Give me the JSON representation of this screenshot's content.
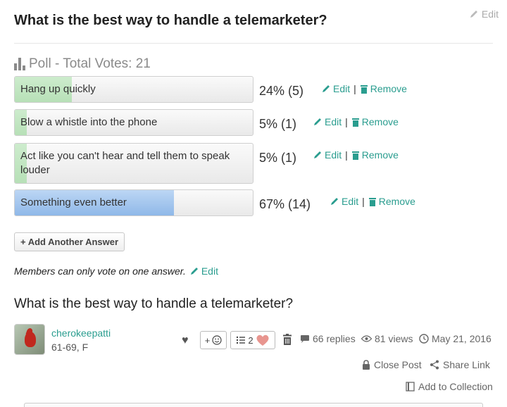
{
  "header": {
    "title": "What is the best way to handle a telemarketer?",
    "edit_label": "Edit"
  },
  "poll": {
    "heading": "Poll - Total Votes: 21",
    "options": [
      {
        "label": "Hang up quickly",
        "result": "24% (5)",
        "fraction": 0.24,
        "color": "green"
      },
      {
        "label": "Blow a whistle into the phone",
        "result": "5% (1)",
        "fraction": 0.05,
        "color": "green"
      },
      {
        "label": "Act like you can't hear and tell them to speak louder",
        "result": "5% (1)",
        "fraction": 0.05,
        "color": "green"
      },
      {
        "label": "Something even better",
        "result": "67% (14)",
        "fraction": 0.67,
        "color": "blue"
      }
    ],
    "edit_label": "Edit",
    "separator": "|",
    "remove_label": "Remove",
    "add_answer_label": "+ Add Another Answer",
    "members_note": "Members can only vote on one answer.",
    "members_edit_label": "Edit"
  },
  "post": {
    "title": "What is the best way to handle a telemarketer?",
    "author": {
      "name": "cherokeepatti",
      "meta": "61-69, F"
    },
    "reaction_plus": "+",
    "list_count": "2",
    "replies": "66 replies",
    "views": "81 views",
    "date": "May 21, 2016",
    "close_post": "Close Post",
    "share_link": "Share Link",
    "add_to_collection": "Add to Collection"
  },
  "colors": {
    "accent": "#2a9d8f",
    "green_fill": "#b7e0b7",
    "blue_fill": "#8fb8e8",
    "heart": "#e8958f"
  }
}
